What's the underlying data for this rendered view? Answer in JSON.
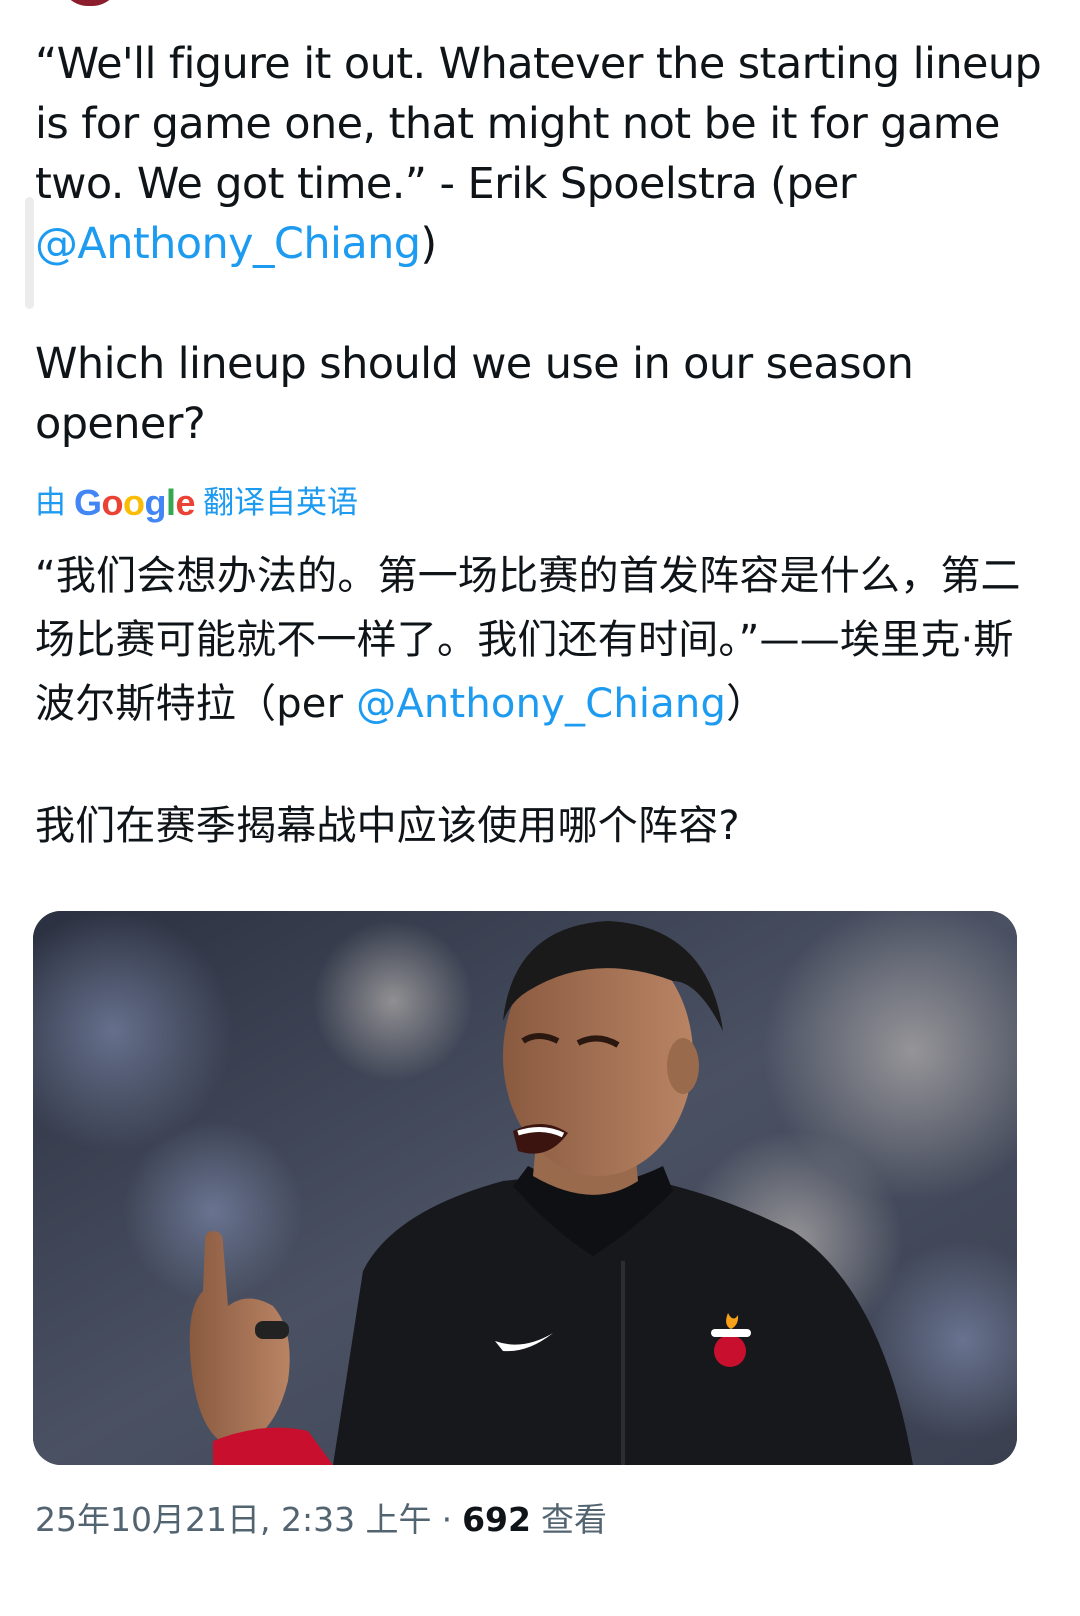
{
  "tweet": {
    "english": {
      "quote_before": "“We'll figure it out. Whatever the starting lineup is for game one, that might not be it for game two. We got time.” - Erik Spoelstra (per ",
      "mention": "@Anthony_Chiang",
      "quote_after": ")",
      "question": "Which lineup should we use in our season opener?"
    },
    "translation": {
      "prefix": "由",
      "provider": "Google",
      "suffix": "翻译自英语"
    },
    "chinese": {
      "quote_before": "“我们会想办法的。第一场比赛的首发阵容是什么，第二场比赛可能就不一样了。我们还有时间。”——埃里克·斯波尔斯特拉（per ",
      "mention": "@Anthony_Chiang",
      "quote_after": "）",
      "question": "我们在赛季揭幕战中应该使用哪个阵容?"
    },
    "image": {
      "subject": "coach-pointing-photo",
      "colors": {
        "jacket": "#17181c",
        "team_red": "#c8102e",
        "background": "#3c4456"
      }
    },
    "meta": {
      "timestamp": "25年10月21日, 2:33 上午",
      "separator": "·",
      "views": "692",
      "views_label": "查看"
    }
  },
  "colors": {
    "link": "#1d9bf0",
    "text": "#0f1419",
    "muted": "#536471"
  }
}
